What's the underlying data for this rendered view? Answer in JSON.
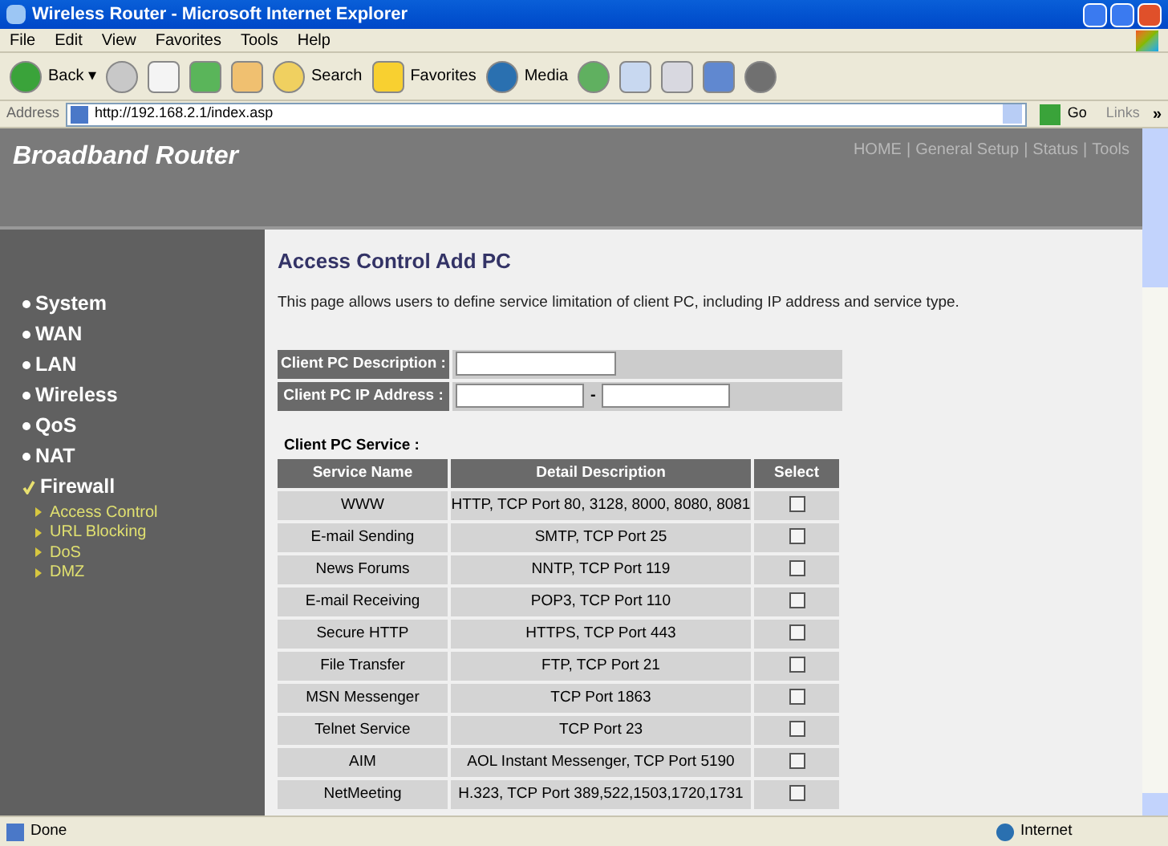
{
  "window": {
    "title": "Wireless Router - Microsoft Internet Explorer"
  },
  "menu": [
    "File",
    "Edit",
    "View",
    "Favorites",
    "Tools",
    "Help"
  ],
  "toolbar": {
    "back": "Back",
    "back_dropdown": "▾",
    "search": "Search",
    "favorites": "Favorites",
    "media": "Media"
  },
  "address_bar": {
    "label": "Address",
    "url": "http://192.168.2.1/index.asp",
    "go": "Go",
    "links": "Links",
    "more": "»"
  },
  "banner": {
    "title": "Broadband Router",
    "links": [
      "HOME",
      "General Setup",
      "Status",
      "Tools"
    ],
    "separator": "|"
  },
  "sidebar": {
    "items": [
      {
        "label": "System",
        "selected": false
      },
      {
        "label": "WAN",
        "selected": false
      },
      {
        "label": "LAN",
        "selected": false
      },
      {
        "label": "Wireless",
        "selected": false
      },
      {
        "label": "QoS",
        "selected": false
      },
      {
        "label": "NAT",
        "selected": false
      },
      {
        "label": "Firewall",
        "selected": true,
        "children": [
          {
            "label": "Access Control"
          },
          {
            "label": "URL Blocking"
          },
          {
            "label": "DoS"
          },
          {
            "label": "DMZ"
          }
        ]
      }
    ]
  },
  "content": {
    "title": "Access Control Add PC",
    "description": "This page allows users to define service limitation of client PC, including IP address and service type.",
    "description_field": {
      "label": "Client PC Description :"
    },
    "ip_field": {
      "label": "Client PC IP Address :",
      "separator": "-"
    },
    "service_label": "Client PC Service :",
    "table": {
      "columns": [
        "Service Name",
        "Detail Description",
        "Select"
      ],
      "rows": [
        {
          "name": "WWW",
          "detail": "HTTP, TCP Port 80, 3128, 8000, 8080, 8081",
          "checked": false
        },
        {
          "name": "E-mail Sending",
          "detail": "SMTP, TCP Port 25",
          "checked": false
        },
        {
          "name": "News Forums",
          "detail": "NNTP, TCP Port 119",
          "checked": false
        },
        {
          "name": "E-mail Receiving",
          "detail": "POP3, TCP Port 110",
          "checked": false
        },
        {
          "name": "Secure HTTP",
          "detail": "HTTPS, TCP Port 443",
          "checked": false
        },
        {
          "name": "File Transfer",
          "detail": "FTP, TCP Port 21",
          "checked": false
        },
        {
          "name": "MSN Messenger",
          "detail": "TCP Port 1863",
          "checked": false
        },
        {
          "name": "Telnet Service",
          "detail": "TCP Port 23",
          "checked": false
        },
        {
          "name": "AIM",
          "detail": "AOL Instant Messenger, TCP Port 5190",
          "checked": false
        },
        {
          "name": "NetMeeting",
          "detail": "H.323, TCP Port 389,522,1503,1720,1731",
          "checked": false
        }
      ]
    }
  },
  "status_bar": {
    "text": "Done",
    "zone": "Internet"
  }
}
